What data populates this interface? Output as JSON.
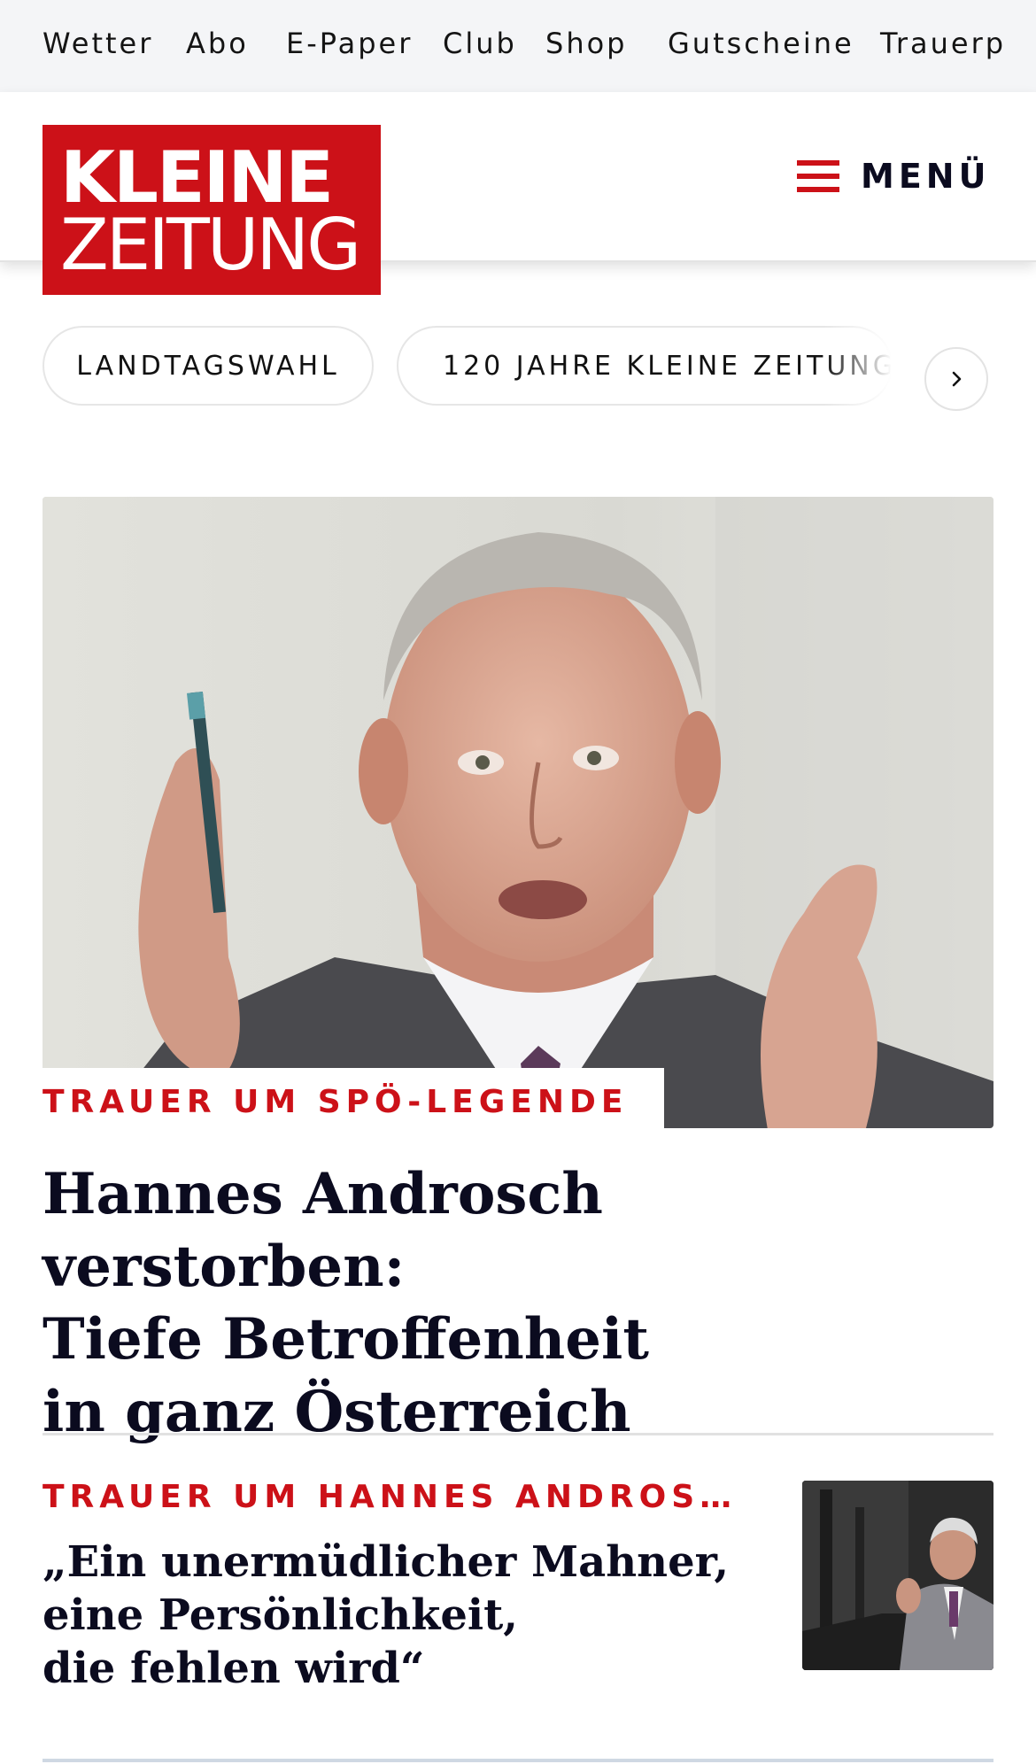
{
  "topnav": {
    "items": [
      {
        "label": "Wetter"
      },
      {
        "label": "Abo"
      },
      {
        "label": "E-Paper"
      },
      {
        "label": "Club"
      },
      {
        "label": "Shop"
      },
      {
        "label": "Gutscheine"
      },
      {
        "label": "Trauerp"
      }
    ]
  },
  "header": {
    "logo_line1": "KLEINE",
    "logo_line2": "ZEITUNG",
    "menu_label": "MENÜ",
    "menu_icon": "hamburger-icon",
    "brand_color": "#cc1118"
  },
  "topics": {
    "chips": [
      {
        "label": "LANDTAGSWAHL"
      },
      {
        "label": "120 JAHRE KLEINE ZEITUNG"
      }
    ],
    "next_icon": "chevron-right-icon"
  },
  "hero": {
    "kicker": "TRAUER UM SPÖ-LEGENDE",
    "title_lines": [
      "Hannes Androsch verstorben:",
      "Tiefe Betroffenheit",
      "in ganz Österreich"
    ]
  },
  "teaser": {
    "kicker": "TRAUER UM HANNES ANDROS…",
    "title_lines": [
      "„Ein unermüdlicher Mahner,",
      "eine Persönlichkeit,",
      "die fehlen wird“"
    ]
  }
}
